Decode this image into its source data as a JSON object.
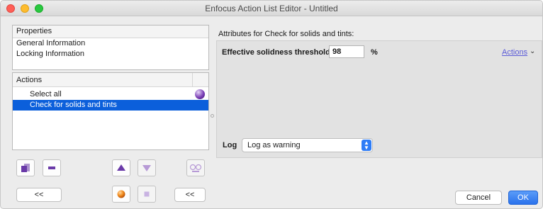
{
  "window": {
    "title": "Enfocus Action List Editor - Untitled"
  },
  "properties": {
    "header": "Properties",
    "items": [
      "General Information",
      "Locking Information"
    ]
  },
  "actions_list": {
    "header": "Actions",
    "items": [
      {
        "label": "Select all",
        "selected": false
      },
      {
        "label": "Check for solids and tints",
        "selected": true
      }
    ]
  },
  "toolbar": {
    "collapse_left_label": "<<",
    "collapse_right_label": "<<"
  },
  "attributes": {
    "title": "Attributes for Check for solids and tints:",
    "threshold_label": "Effective solidness threshold",
    "threshold_value": "98",
    "threshold_unit": "%",
    "actions_menu_label": "Actions",
    "log_label": "Log",
    "log_value": "Log as warning"
  },
  "footer": {
    "cancel_label": "Cancel",
    "ok_label": "OK"
  },
  "colors": {
    "selection": "#0b5fdb",
    "ok_button": "#2a72ec",
    "link": "#5b5bd8",
    "icon_purple": "#6a3aa8",
    "icon_orange": "#f08a1c"
  },
  "icons": {
    "add_action": "add-action-icon",
    "remove_action": "minus-icon",
    "move_up": "triangle-up-icon",
    "move_down": "triangle-down-icon",
    "view": "glasses-icon",
    "run": "orange-dot-icon",
    "stop": "stop-square-icon"
  }
}
